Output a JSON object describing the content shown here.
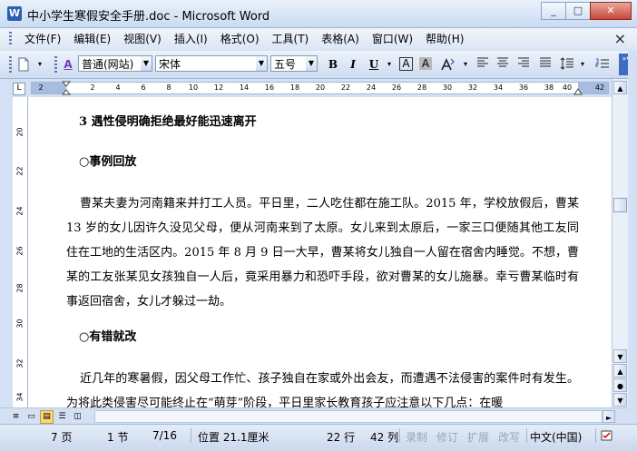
{
  "window": {
    "title": "中小学生寒假安全手册.doc - Microsoft Word",
    "app_icon": "W",
    "minimize": "_",
    "maximize": "□",
    "close": "✕"
  },
  "menu": {
    "items": [
      "文件(F)",
      "编辑(E)",
      "视图(V)",
      "插入(I)",
      "格式(O)",
      "工具(T)",
      "表格(A)",
      "窗口(W)",
      "帮助(H)"
    ],
    "close": "×"
  },
  "toolbar": {
    "style": "普通(网站)",
    "font": "宋体",
    "size": "五号",
    "bold": "B",
    "italic": "I",
    "underline": "U",
    "char_border": "A",
    "char_shading": "A",
    "styles_icon": "A",
    "new_doc_icon": "new-document-icon"
  },
  "ruler": {
    "h_ticks": [
      "2",
      "2",
      "4",
      "6",
      "8",
      "10",
      "12",
      "14",
      "16",
      "18",
      "20",
      "22",
      "24",
      "26",
      "28",
      "30",
      "32",
      "34",
      "36",
      "38",
      "40",
      "42"
    ],
    "v_ticks": [
      "20",
      "22",
      "24",
      "26",
      "28",
      "30",
      "32",
      "34"
    ],
    "tab_selector": "L"
  },
  "document": {
    "heading1": "3 遇性侵明确拒绝最好能迅速离开",
    "heading2": "○事例回放",
    "para1": "曹某夫妻为河南籍来并打工人员。平日里，二人吃住都在施工队。2015 年，学校放假后，曹某 13 岁的女儿因许久没见父母，便从河南来到了太原。女儿来到太原后，一家三口便随其他工友同住在工地的生活区内。2015 年 8 月 9 日一大早，曹某将女儿独自一人留在宿舍内睡觉。不想，曹某的工友张某见女孩独自一人后，竟采用暴力和恐吓手段，欲对曹某的女儿施暴。幸亏曹某临时有事返回宿舍，女儿才躲过一劫。",
    "heading3": "○有错就改",
    "para2": "近几年的寒暑假，因父母工作忙、孩子独自在家或外出会友，而遭遇不法侵害的案件时有发生。为将此类侵害尽可能终止在“萌芽”阶段，平日里家长教育孩子应注意以下几点：在暖"
  },
  "status": {
    "page": "7 页",
    "section": "1 节",
    "page_of": "7/16",
    "position": "位置 21.1厘米",
    "line": "22 行",
    "column": "42 列",
    "rec": "录制",
    "trk": "修订",
    "ext": "扩展",
    "ovr": "改写",
    "language": "中文(中国)"
  }
}
